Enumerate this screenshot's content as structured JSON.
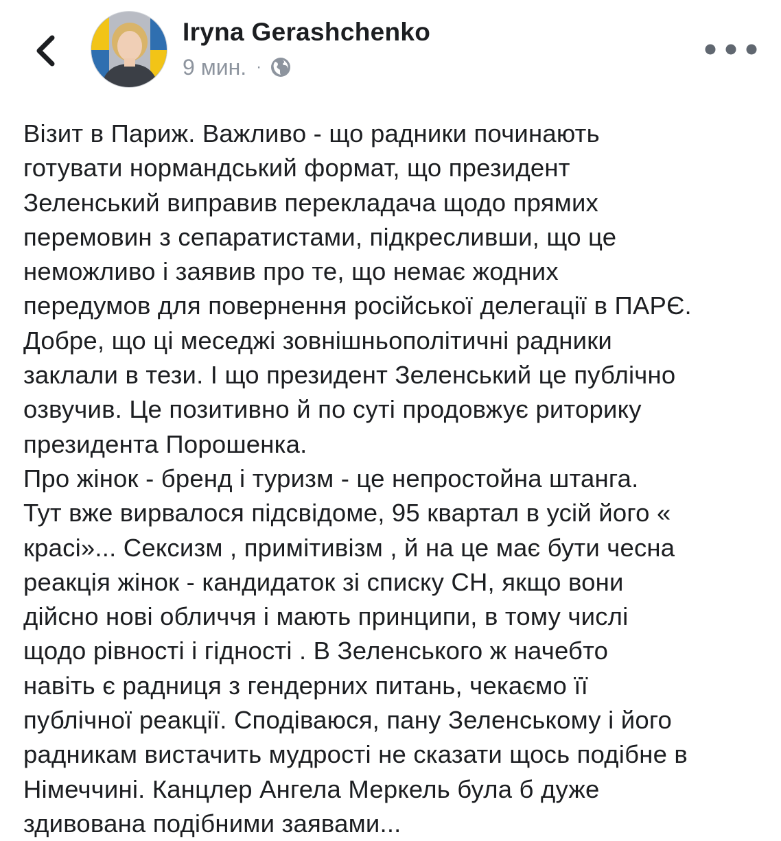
{
  "header": {
    "back_icon": "chevron-left-icon",
    "author_name": "Iryna Gerashchenko",
    "timestamp": "9 мин.",
    "separator": "·",
    "privacy_icon": "globe-icon",
    "more_icon": "more-horizontal-icon"
  },
  "post": {
    "lines": [
      "Візит в Париж. Важливо  - що радники починають",
      "готувати нормандський формат, що президент",
      "Зеленський виправив перекладача щодо  прямих",
      "перемовин з сепаратистами, підкресливши, що це",
      "неможливо  і заявив  про те, що немає жодних",
      "передумов для повернення російської делегації в ПАРЄ.",
      "Добре, що ці меседжі зовнішньополітичні радники",
      "заклали в тези. І що президент  Зеленський це публічно",
      "озвучив. Це позитивно й по суті продовжує риторику",
      "президента Порошенка.",
      "Про жінок - бренд і туризм  - це непростойна  штанга.",
      "Тут вже вирвалося підсвідоме,  95 квартал в усій його «",
      "красі»... Сексизм , примітивізм , й на це має бути чесна",
      "реакція жінок - кандидаток зі списку СН, якщо вони",
      "дійсно нові обличчя і мають принципи, в тому числі",
      "щодо  рівності  і гідності . В Зеленського ж начебто",
      "навіть є радниця з гендерних питань, чекаємо її",
      "публічної реакції. Сподіваюся, пану Зеленському і його",
      "радникам вистачить мудрості не сказати  щось подібне в",
      "Німеччині. Канцлер Ангела Меркель була б дуже",
      "здивована подібними заявами..."
    ]
  },
  "colors": {
    "text_primary": "#1c1e21",
    "text_secondary": "#8d949e",
    "background": "#ffffff",
    "avatar_flag_blue": "#2f6fb0",
    "avatar_flag_yellow": "#f2c417"
  }
}
